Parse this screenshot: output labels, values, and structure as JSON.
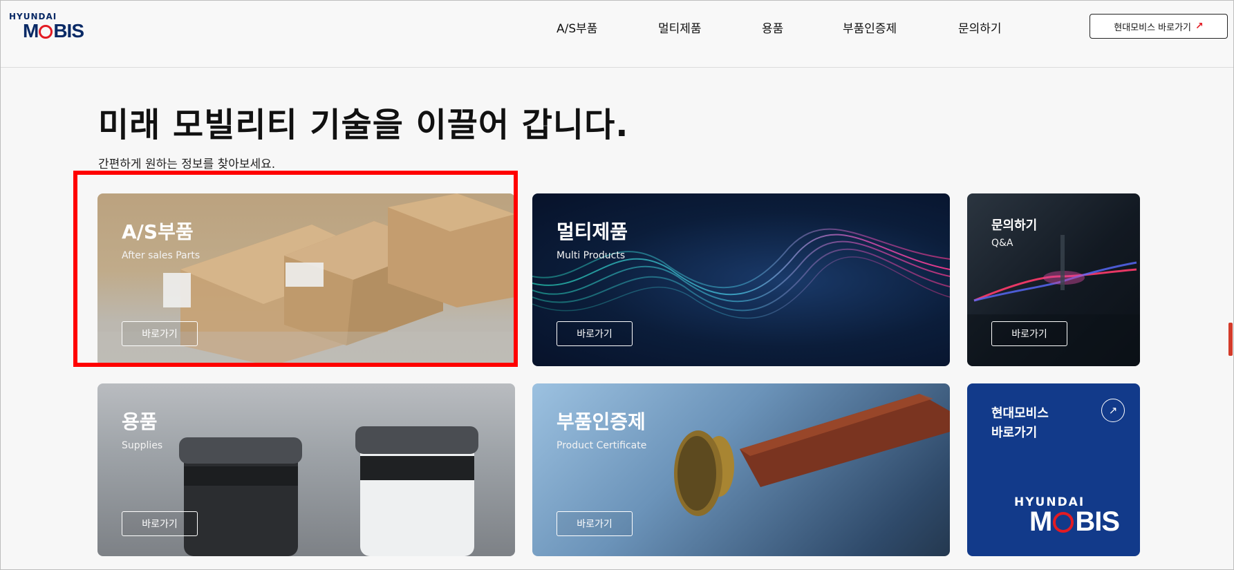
{
  "brand": {
    "logo_top": "HYUNDAI",
    "logo_main_pre": "M",
    "logo_main_post": "BIS",
    "accent": "#e31b23",
    "navy": "#0a2a66"
  },
  "nav": {
    "items": [
      {
        "label": "A/S부품"
      },
      {
        "label": "멀티제품"
      },
      {
        "label": "용품"
      },
      {
        "label": "부품인증제"
      },
      {
        "label": "문의하기"
      }
    ],
    "shortcut_label": "현대모비스 바로가기",
    "shortcut_icon": "arrow-up-right-icon"
  },
  "hero": {
    "title": "미래 모빌리티 기술을 이끌어 갑니다.",
    "subtitle": "간편하게 원하는 정보를 찾아보세요."
  },
  "cards": [
    {
      "title": "A/S부품",
      "subtitle": "After sales Parts",
      "button": "바로가기"
    },
    {
      "title": "멀티제품",
      "subtitle": "Multi Products",
      "button": "바로가기"
    },
    {
      "title": "문의하기",
      "subtitle": "Q&A",
      "button": "바로가기"
    },
    {
      "title": "용품",
      "subtitle": "Supplies",
      "button": "바로가기"
    },
    {
      "title": "부품인증제",
      "subtitle": "Product Certificate",
      "button": "바로가기"
    },
    {
      "title_line1": "현대모비스",
      "title_line2": "바로가기",
      "logo_top": "HYUNDAI",
      "logo_main_pre": "M",
      "logo_main_post": "BIS",
      "icon": "arrow-up-right-icon"
    }
  ],
  "highlight": {
    "color": "#ff0000"
  }
}
